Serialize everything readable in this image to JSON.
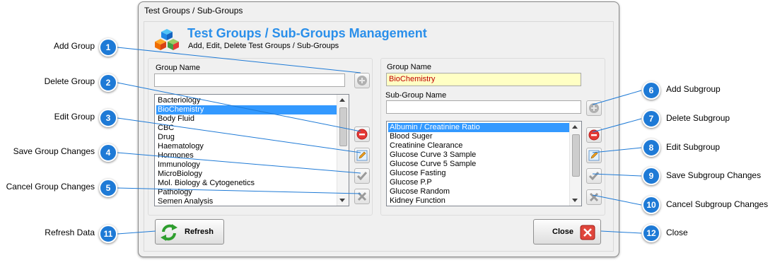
{
  "window": {
    "title": "Test Groups / Sub-Groups"
  },
  "header": {
    "title": "Test Groups / Sub-Groups Management",
    "subtitle": "Add, Edit, Delete Test Groups / Sub-Groups"
  },
  "groups": {
    "name_label": "Group Name",
    "name_value": "",
    "items": [
      "Bacteriology",
      "BioChemistry",
      "Body Fluid",
      "CBC",
      "Drug",
      "Haematology",
      "Hormones",
      "Immunology",
      "MicroBiology",
      "Mol. Biology & Cytogenetics",
      "Pathology",
      "Semen Analysis"
    ],
    "selected": "BioChemistry"
  },
  "subgroups": {
    "group_label": "Group Name",
    "group_value": "BioChemistry",
    "name_label": "Sub-Group Name",
    "name_value": "",
    "items": [
      "Albumin / Creatinine Ratio",
      "Blood Suger",
      "Creatinine Clearance",
      "Glucose Curve 3 Sample",
      "Glucose Curve 5 Sample",
      "Glucose Fasting",
      "Glucose P.P",
      "Glucose Random",
      "Kidney Function"
    ],
    "selected": "Albumin / Creatinine Ratio"
  },
  "buttons": {
    "refresh": "Refresh",
    "close": "Close"
  },
  "callouts": [
    {
      "num": "1",
      "label": "Add Group"
    },
    {
      "num": "2",
      "label": "Delete Group"
    },
    {
      "num": "3",
      "label": "Edit Group"
    },
    {
      "num": "4",
      "label": "Save Group Changes"
    },
    {
      "num": "5",
      "label": "Cancel Group Changes"
    },
    {
      "num": "6",
      "label": "Add Subgroup"
    },
    {
      "num": "7",
      "label": "Delete Subgroup"
    },
    {
      "num": "8",
      "label": "Edit Subgroup"
    },
    {
      "num": "9",
      "label": "Save Subgroup Changes"
    },
    {
      "num": "10",
      "label": "Cancel Subgroup Changes"
    },
    {
      "num": "11",
      "label": "Refresh Data"
    },
    {
      "num": "12",
      "label": "Close"
    }
  ],
  "colors": {
    "accent": "#2a8fea",
    "callout": "#1e7ad6",
    "selection": "#3399ff",
    "highlight_field": "#ffffc4"
  }
}
